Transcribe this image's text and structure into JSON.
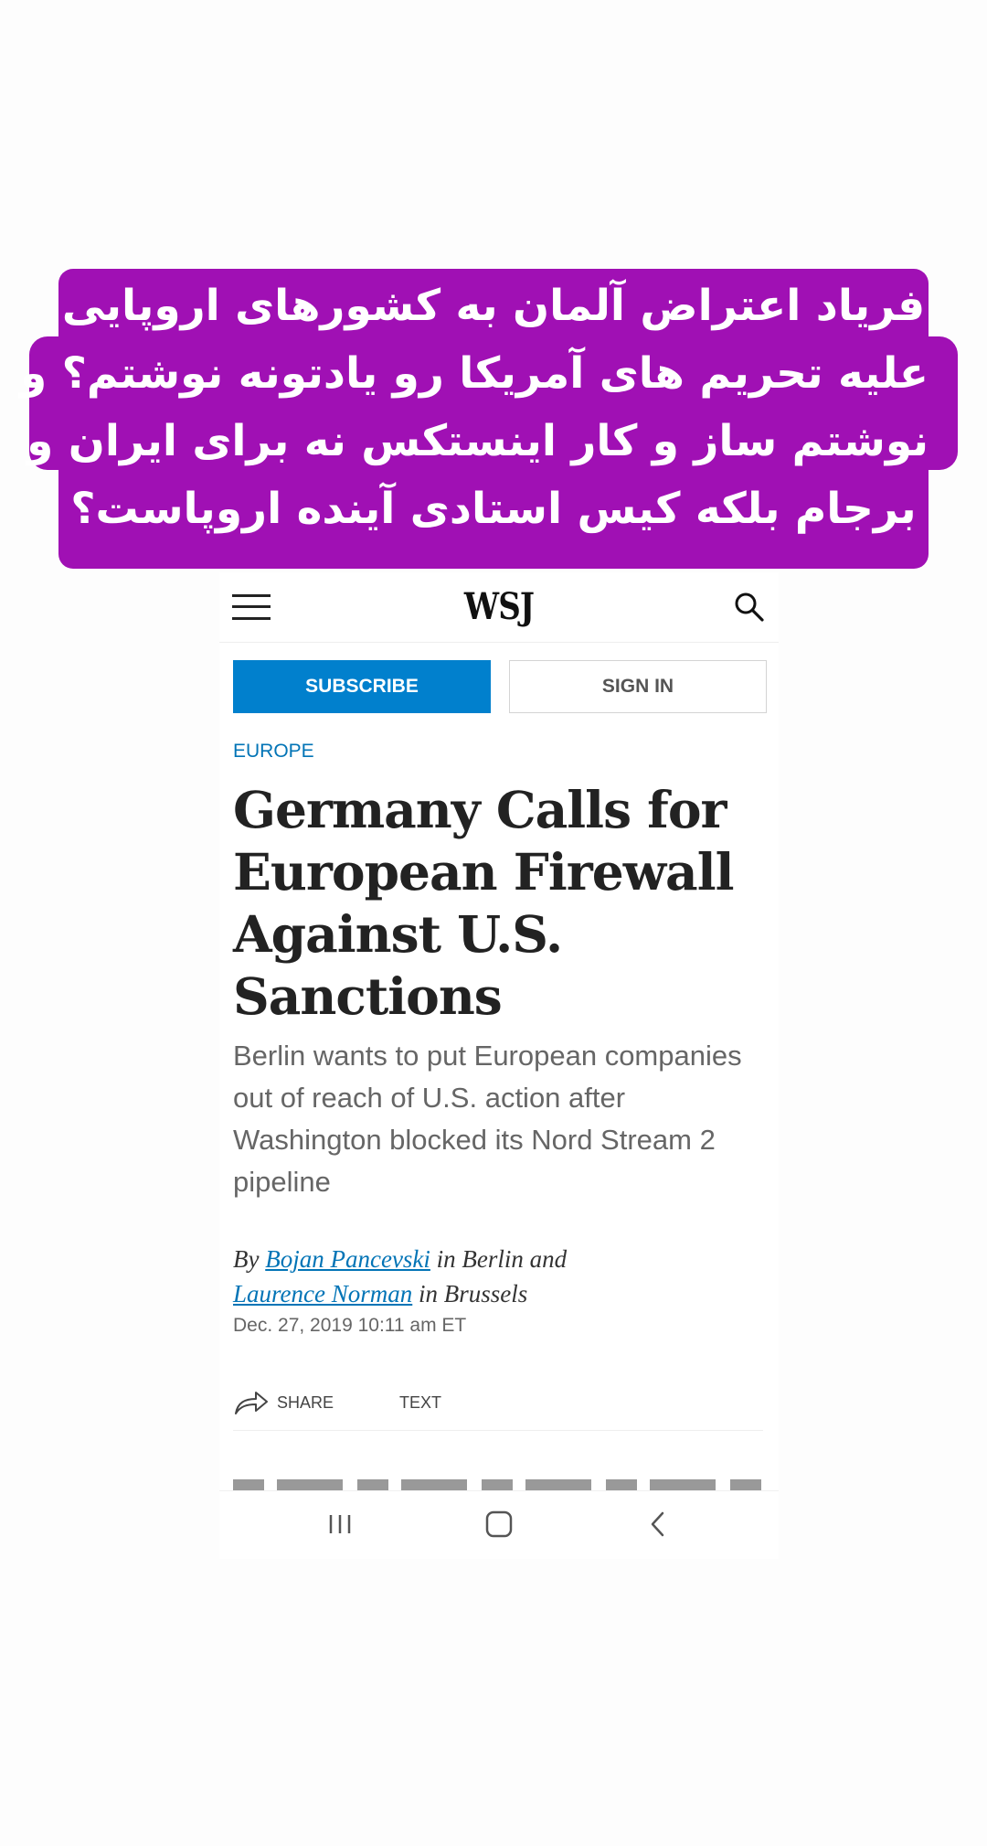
{
  "caption": {
    "lines": [
      "فریاد اعتراض آلمان به کشورهای اروپایی",
      "علیه تحریم های آمریکا رو یادتونه نوشتم؟ و",
      "نوشتم ساز و کار اینستکس نه برای ایران و",
      "برجام بلکه کیس استادی آینده اروپاست؟"
    ],
    "background_color": "#a010b4"
  },
  "topbar": {
    "menu_icon": "hamburger-menu-icon",
    "logo": "WSJ",
    "search_icon": "search-icon"
  },
  "auth": {
    "subscribe_label": "SUBSCRIBE",
    "signin_label": "SIGN IN",
    "subscribe_color": "#0180cd"
  },
  "article": {
    "section": "EUROPE",
    "headline": "Germany Calls for European Firewall Against U.S. Sanctions",
    "dek": "Berlin wants to put European companies out of reach of U.S. action after Washington blocked its Nord Stream 2 pipeline",
    "byline": {
      "prefix": "By",
      "author1": "Bojan Pancevski",
      "loc1": "in Berlin and",
      "author2": "Laurence Norman",
      "loc2": "in Brussels"
    },
    "date": "Dec. 27, 2019 10:11 am ET"
  },
  "tools": {
    "share_icon": "share-arrow-icon",
    "share_label": "SHARE",
    "text_label": "TEXT"
  },
  "navbar": {
    "recents_icon": "recent-apps-icon",
    "home_icon": "home-icon",
    "back_icon": "back-icon"
  }
}
